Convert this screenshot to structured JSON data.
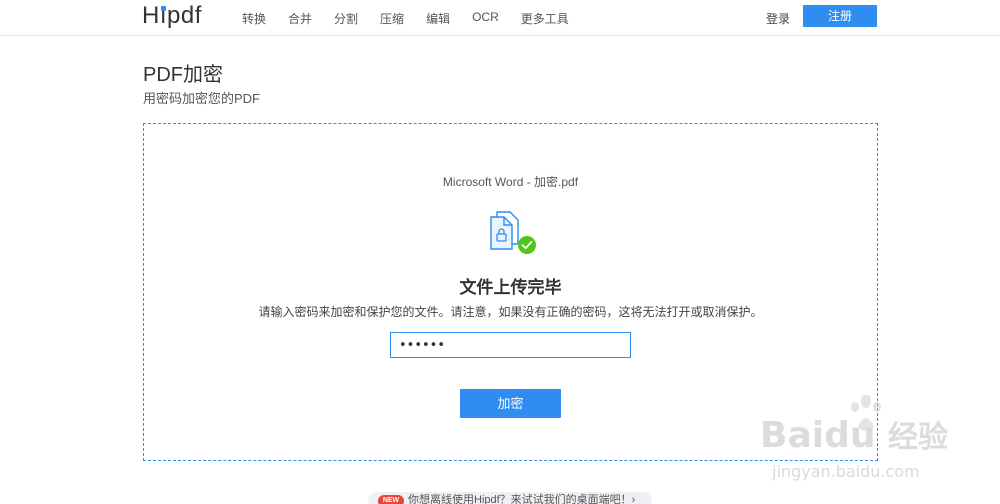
{
  "header": {
    "logo": "Hipdf",
    "nav": [
      "转换",
      "合并",
      "分割",
      "压缩",
      "编辑",
      "OCR",
      "更多工具"
    ],
    "login_label": "登录",
    "register_label": "注册"
  },
  "page": {
    "title": "PDF加密",
    "subtitle": "用密码加密您的PDF"
  },
  "upload": {
    "filename": "Microsoft Word - 加密.pdf",
    "status": "文件上传完毕",
    "description": "请输入密码来加密和保护您的文件。请注意，如果没有正确的密码，这将无法打开或取消保护。",
    "password_value": "••••••",
    "encrypt_label": "加密"
  },
  "promo": {
    "badge": "NEW",
    "text": "你想离线使用Hipdf？来试试我们的桌面端吧！›"
  },
  "watermark": {
    "brand": "Baidu",
    "suffix": "经验",
    "url": "jingyan.baidu.com"
  },
  "colors": {
    "accent": "#2f8cf0",
    "success": "#52c41a"
  },
  "icons": {
    "file": "pdf-file-lock-icon",
    "check": "check-badge-icon"
  }
}
